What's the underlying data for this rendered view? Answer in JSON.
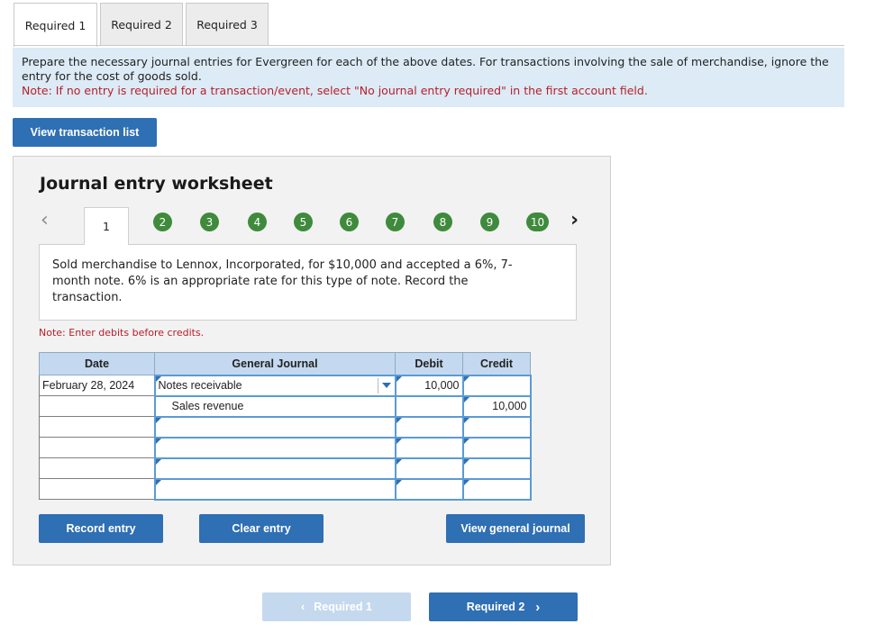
{
  "tabs": [
    "Required 1",
    "Required 2",
    "Required 3"
  ],
  "instructions": {
    "text": "Prepare the necessary journal entries for Evergreen for each of the above dates. For transactions involving the sale of merchandise, ignore the entry for the cost of goods sold.",
    "note": "Note: If no entry is required for a transaction/event, select \"No journal entry required\" in the first account field."
  },
  "view_transaction_list": "View transaction list",
  "worksheet": {
    "title": "Journal entry worksheet",
    "current_step": "1",
    "steps": [
      "2",
      "3",
      "4",
      "5",
      "6",
      "7",
      "8",
      "9",
      "10"
    ],
    "description": "Sold merchandise to Lennox, Incorporated, for $10,000 and accepted a 6%, 7-month note. 6% is an appropriate rate for this type of note. Record the transaction.",
    "note": "Note: Enter debits before credits.",
    "columns": {
      "date": "Date",
      "journal": "General Journal",
      "debit": "Debit",
      "credit": "Credit"
    },
    "rows": [
      {
        "date": "February 28, 2024",
        "account": "Notes receivable",
        "debit": "10,000",
        "credit": ""
      },
      {
        "date": "",
        "account": "Sales revenue",
        "debit": "",
        "credit": "10,000"
      },
      {
        "date": "",
        "account": "",
        "debit": "",
        "credit": ""
      },
      {
        "date": "",
        "account": "",
        "debit": "",
        "credit": ""
      },
      {
        "date": "",
        "account": "",
        "debit": "",
        "credit": ""
      },
      {
        "date": "",
        "account": "",
        "debit": "",
        "credit": ""
      }
    ],
    "buttons": {
      "record": "Record entry",
      "clear": "Clear entry",
      "view_journal": "View general journal"
    }
  },
  "bottom_nav": {
    "prev": "Required 1",
    "next": "Required 2"
  },
  "colors": {
    "accent": "#2f6fb3",
    "step_green": "#3f8a3c",
    "note_red": "#b8202a",
    "info_bg": "#dcebf6"
  }
}
